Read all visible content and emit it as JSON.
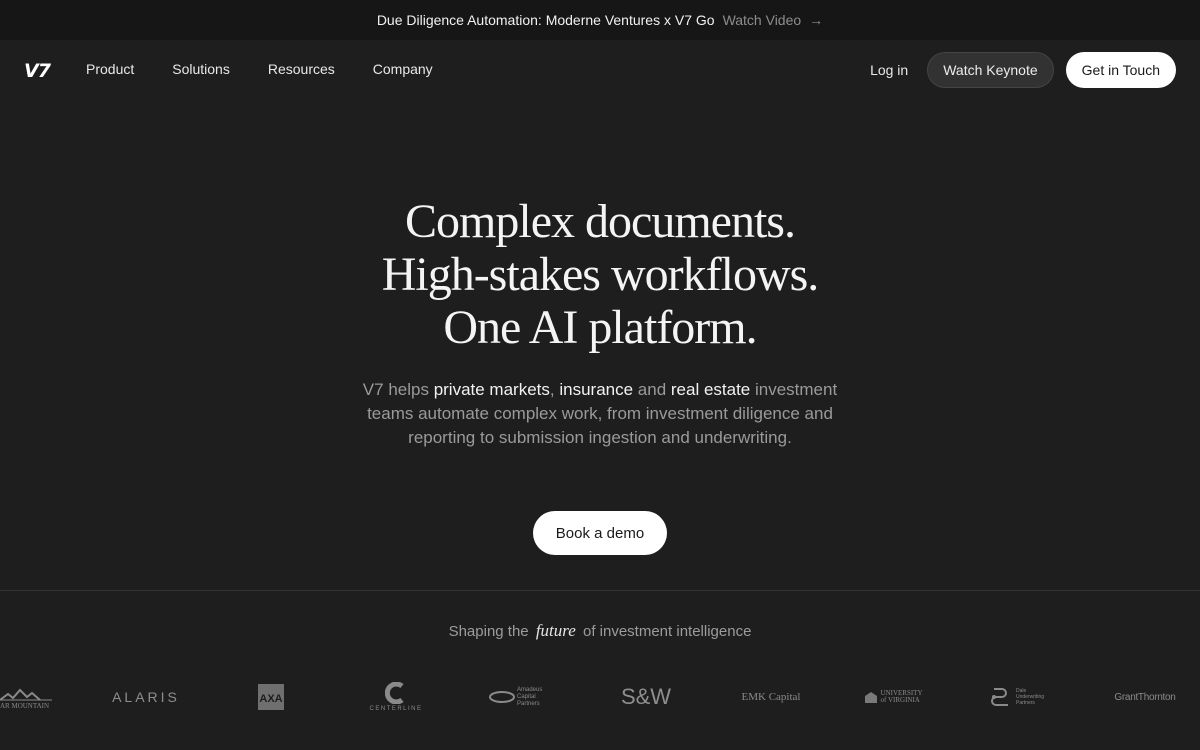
{
  "announcement": {
    "message": "Due Diligence Automation: Moderne Ventures x V7 Go",
    "link": "Watch Video",
    "arrow_icon": "arrow-right-icon"
  },
  "nav": {
    "logo": "V7",
    "menu": [
      "Product",
      "Solutions",
      "Resources",
      "Company"
    ],
    "login": "Log in",
    "watch_keynote": "Watch Keynote",
    "get_in_touch": "Get in Touch"
  },
  "hero": {
    "title_lines": [
      "Complex documents.",
      "High-stakes workflows.",
      "One AI platform."
    ],
    "sub": {
      "p1": "V7 helps ",
      "h1": "private markets",
      "p2": ", ",
      "h2": "insurance",
      "p3": " and ",
      "h3": "real estate",
      "p4": " investment teams automate complex work, from investment diligence and reporting to submission ingestion and underwriting."
    },
    "cta": "Book a demo"
  },
  "trust": {
    "pre": "Shaping the",
    "future": "future",
    "post": "of investment intelligence",
    "logos": [
      "AR MOUNTAIN",
      "ALARIS",
      "AXA",
      "CENTERLINE",
      "Amadeus Capital Partners",
      "S&W",
      "EMK Capital",
      "UNIVERSITY of VIRGINIA",
      "Dale Underwriting Partners",
      "GrantThornton"
    ]
  },
  "colors": {
    "background": "#1f1e1e",
    "announcement_bg": "#161616",
    "button_white": "#ffffff",
    "muted_text": "#9a9a9a"
  }
}
